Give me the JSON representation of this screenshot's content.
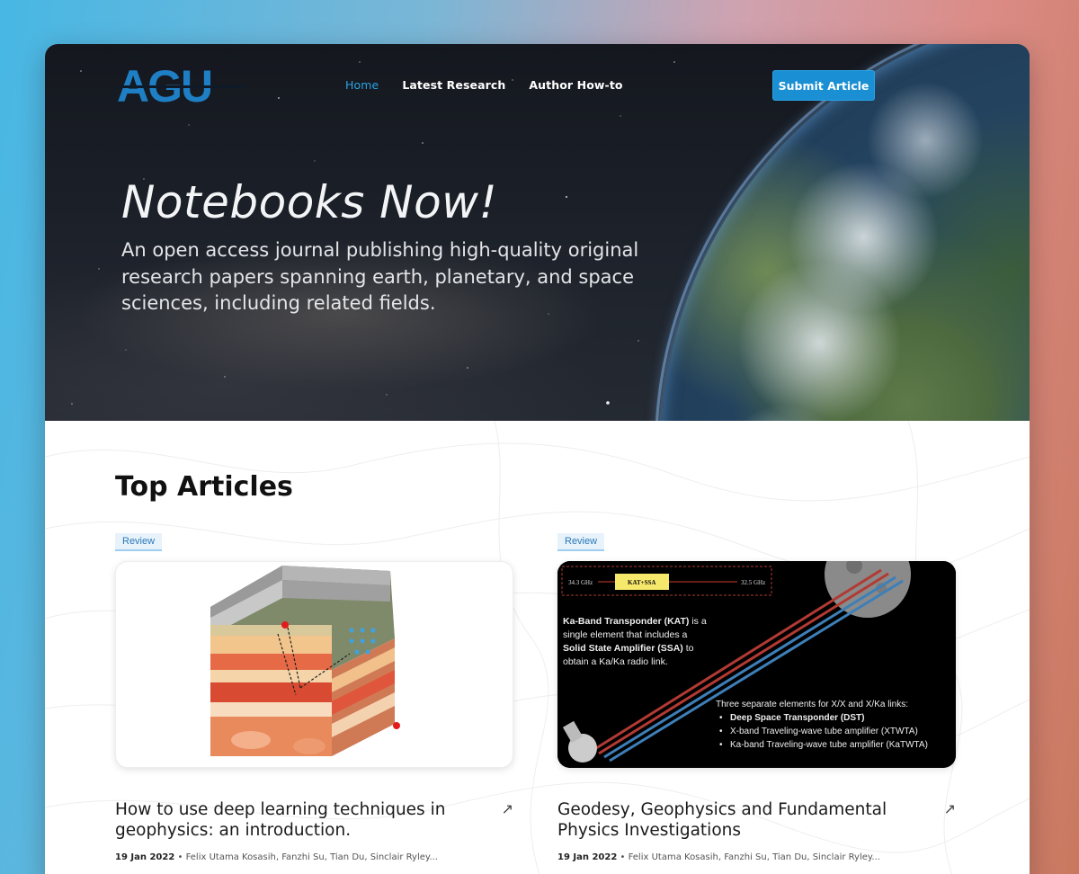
{
  "brand": {
    "logo_text": "AGU"
  },
  "nav": {
    "items": [
      {
        "label": "Home",
        "active": true
      },
      {
        "label": "Latest Research",
        "active": false
      },
      {
        "label": "Author How-to",
        "active": false
      }
    ],
    "submit_label": "Submit Article"
  },
  "hero": {
    "title": "Notebooks Now!",
    "subtitle": "An open access journal publishing high-quality original research papers spanning earth, planetary, and space sciences, including related fields."
  },
  "section": {
    "title": "Top Articles"
  },
  "articles": [
    {
      "badge": "Review",
      "title": "How to use deep learning techniques in geophysics: an introduction.",
      "date": "19 Jan 2022",
      "authors": "Felix Utama Kosasih, Fanzhi Su, Tian Du, Sinclair Ryley..."
    },
    {
      "badge": "Review",
      "title": "Geodesy, Geophysics and Fundamental Physics Investigations",
      "date": "19 Jan 2022",
      "authors": "Felix Utama Kosasih, Fanzhi Su, Tian Du, Sinclair Ryley...",
      "figure": {
        "freq_left": "34.3 GHz",
        "freq_right": "32.5 GHz",
        "box_label": "KAT+SSA",
        "para_1": "Ka-Band Transponder (KAT) is a single element that includes a Solid State Amplifier (SSA) to obtain a Ka/Ka radio link.",
        "para_2_head": "Three separate elements for X/X and X/Ka links:",
        "bullets": [
          "Deep Space Transponder (DST)",
          "X-band Traveling-wave tube amplifier (XTWTA)",
          "Ka-band Traveling-wave tube amplifier (KaTWTA)"
        ]
      }
    }
  ],
  "colors": {
    "accent": "#1a8fd3",
    "nav_active": "#2aa3e5",
    "badge_bg": "#e7f2fb"
  }
}
